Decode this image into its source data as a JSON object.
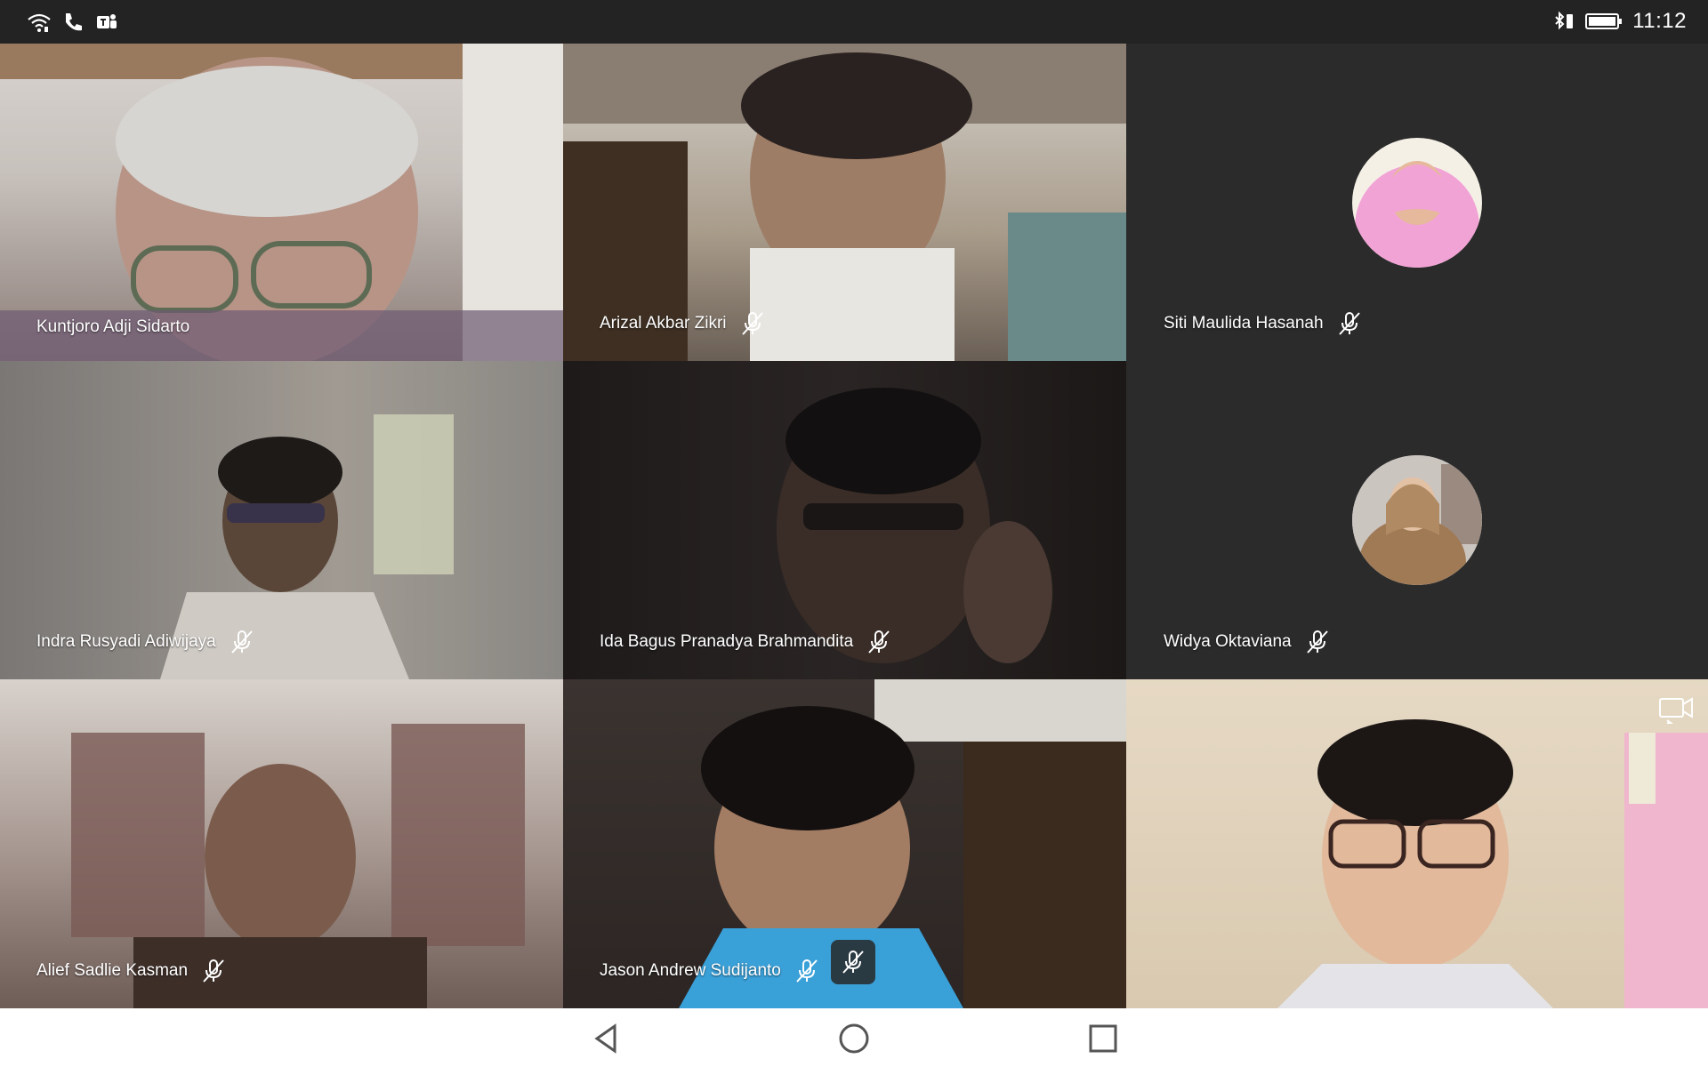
{
  "status_bar": {
    "time": "11:12",
    "left_icons": [
      "wifi-calling-icon",
      "phone-icon",
      "teams-icon"
    ],
    "right_icons": [
      "bluetooth-battery-icon",
      "battery-icon"
    ]
  },
  "participants": [
    {
      "name": "Kuntjoro Adji Sidarto",
      "muted": false,
      "video": true
    },
    {
      "name": "Arizal Akbar Zikri",
      "muted": true,
      "video": true
    },
    {
      "name": "Siti Maulida Hasanah",
      "muted": true,
      "video": false
    },
    {
      "name": "Indra Rusyadi Adiwijaya",
      "muted": true,
      "video": true
    },
    {
      "name": "Ida Bagus Pranadya Brahmandita",
      "muted": true,
      "video": true
    },
    {
      "name": "Widya Oktaviana",
      "muted": true,
      "video": false
    },
    {
      "name": "Alief Sadlie Kasman",
      "muted": true,
      "video": true
    },
    {
      "name": "Jason Andrew Sudijanto",
      "muted": true,
      "video": true
    },
    {
      "name": "",
      "muted": false,
      "video": true
    }
  ],
  "controls": {
    "self_mute_icon": "mic-off-icon",
    "switch_camera_icon": "switch-camera-icon"
  },
  "nav_bar": {
    "icons": [
      "back-icon",
      "home-icon",
      "recents-icon"
    ]
  },
  "colors": {
    "status_bar_bg": "#232323",
    "tile_no_video_bg": "#2b2b2b",
    "nav_bar_bg": "#ffffff",
    "avatar_pink": "#f2a3d6"
  }
}
